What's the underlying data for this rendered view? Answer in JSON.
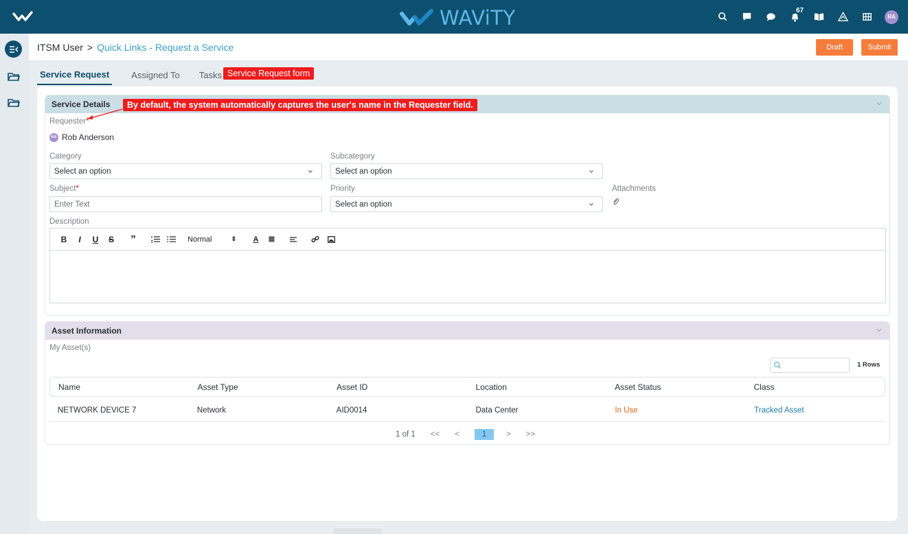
{
  "brand": {
    "name": "WAViTY",
    "color": "#5db7ea"
  },
  "topbar": {
    "notification_count": "67",
    "avatar_initials": "RA",
    "bg": "#0d4f6e"
  },
  "breadcrumb": {
    "root": "ITSM User",
    "separator": ">",
    "current": "Quick Links - Request a Service"
  },
  "actions": {
    "draft": "Draft",
    "submit": "Submit",
    "accent": "#f57c3b"
  },
  "tabs": [
    {
      "label": "Service Request",
      "active": true
    },
    {
      "label": "Assigned To",
      "active": false
    },
    {
      "label": "Tasks",
      "active": false
    }
  ],
  "annotations": {
    "tab_callout": "Service Request form",
    "requester_callout": "By default, the system automatically captures the user's name in the Requester field."
  },
  "service_details": {
    "title": "Service Details",
    "requester_label": "Requester",
    "required_mark": "*",
    "requester_initials": "RA",
    "requester_name": "Rob Anderson",
    "category_label": "Category",
    "category_value": "Select an option",
    "subcategory_label": "Subcategory",
    "subcategory_value": "Select an option",
    "subject_label": "Subject",
    "subject_placeholder": "Enter Text",
    "priority_label": "Priority",
    "priority_value": "Select an option",
    "attachments_label": "Attachments",
    "description_label": "Description",
    "editor_format": "Normal"
  },
  "asset_info": {
    "title": "Asset Information",
    "my_assets_label": "My Asset(s)",
    "rows_count": "1 Rows",
    "columns": [
      "Name",
      "Asset Type",
      "Asset ID",
      "Location",
      "Asset Status",
      "Class"
    ],
    "rows": [
      {
        "name": "NETWORK DEVICE 7",
        "type": "Network",
        "id": "AID0014",
        "location": "Data Center",
        "status": "In Use",
        "class": "Tracked Asset"
      }
    ],
    "pagination": {
      "summary": "1 of 1",
      "first": "<<",
      "prev": "<",
      "current": "1",
      "next": ">",
      "last": ">>"
    }
  }
}
